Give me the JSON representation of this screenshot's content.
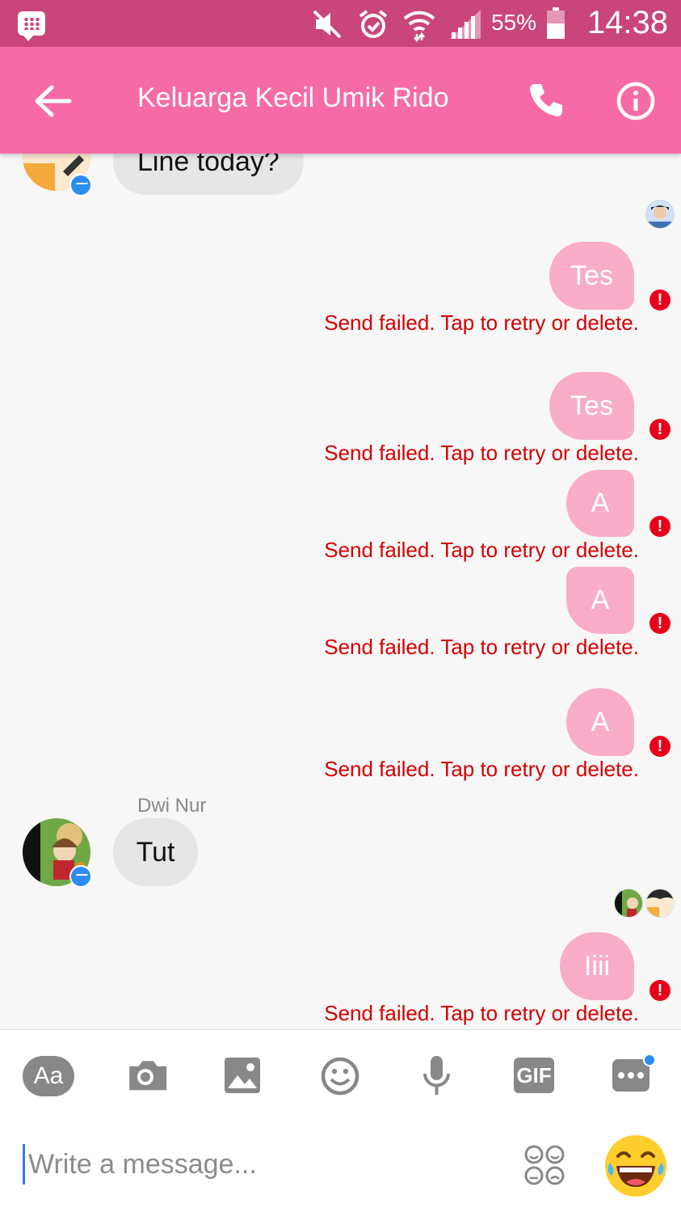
{
  "status_bar": {
    "battery": "55%",
    "time": "14:38"
  },
  "header": {
    "title": "Keluarga Kecil Umik Rido"
  },
  "messages": {
    "top_partial_text": "Line today?",
    "outgoing": [
      {
        "text": "Tes"
      },
      {
        "text": "Tes"
      },
      {
        "text": "A"
      },
      {
        "text": "A"
      },
      {
        "text": "A"
      },
      {
        "text": "Iiii"
      }
    ],
    "error_text": "Send failed. Tap to retry or delete.",
    "error_icon": "!",
    "incoming_sender": "Dwi Nur",
    "incoming_text": "Tut"
  },
  "composer": {
    "aa_label": "Aa",
    "gif_label": "GIF",
    "placeholder": "Write a message..."
  },
  "colors": {
    "status_bar": "#c9457a",
    "toolbar": "#f66ba6",
    "outgoing_bubble": "#f9adc9",
    "error": "#d30000",
    "accent": "#2d8cf0"
  }
}
